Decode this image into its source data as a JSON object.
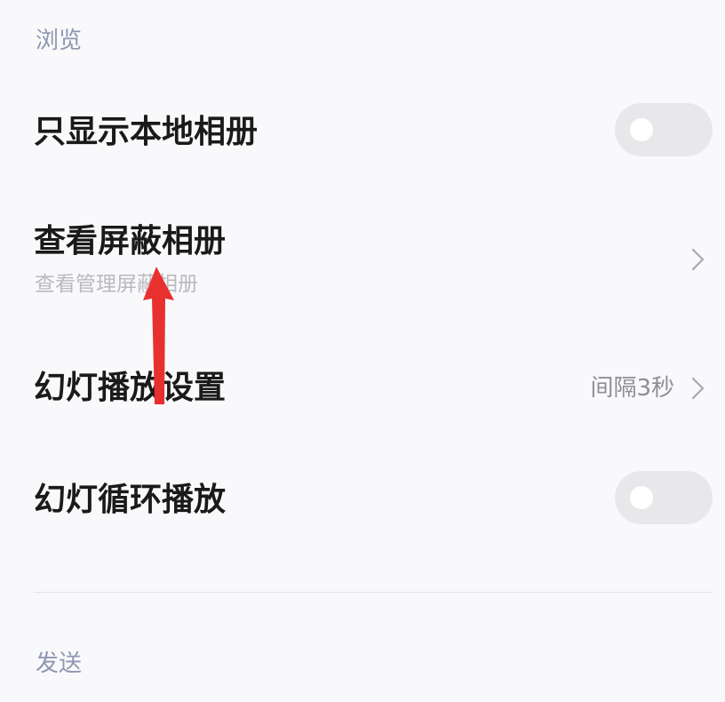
{
  "sections": {
    "browse": {
      "label": "浏览"
    },
    "send": {
      "label": "发送"
    }
  },
  "rows": {
    "local_albums_only": {
      "title": "只显示本地相册",
      "toggle_on": false,
      "icon": "toggle-switch-icon"
    },
    "hidden_albums": {
      "title": "查看屏蔽相册",
      "subtitle": "查看管理屏蔽相册",
      "icon": "chevron-right-icon"
    },
    "slideshow_settings": {
      "title": "幻灯播放设置",
      "value": "间隔3秒",
      "icon": "chevron-right-icon"
    },
    "slideshow_loop": {
      "title": "幻灯循环播放",
      "toggle_on": false,
      "icon": "toggle-switch-icon"
    }
  },
  "annotation": {
    "icon": "red-arrow-up-icon",
    "color": "#e8312f"
  },
  "colors": {
    "background": "#f9f9fb",
    "section_header": "#8e97b1",
    "toggle_off": "#e8e8eb",
    "title_text": "#1a1a1a",
    "secondary_text": "#8f8f94"
  }
}
